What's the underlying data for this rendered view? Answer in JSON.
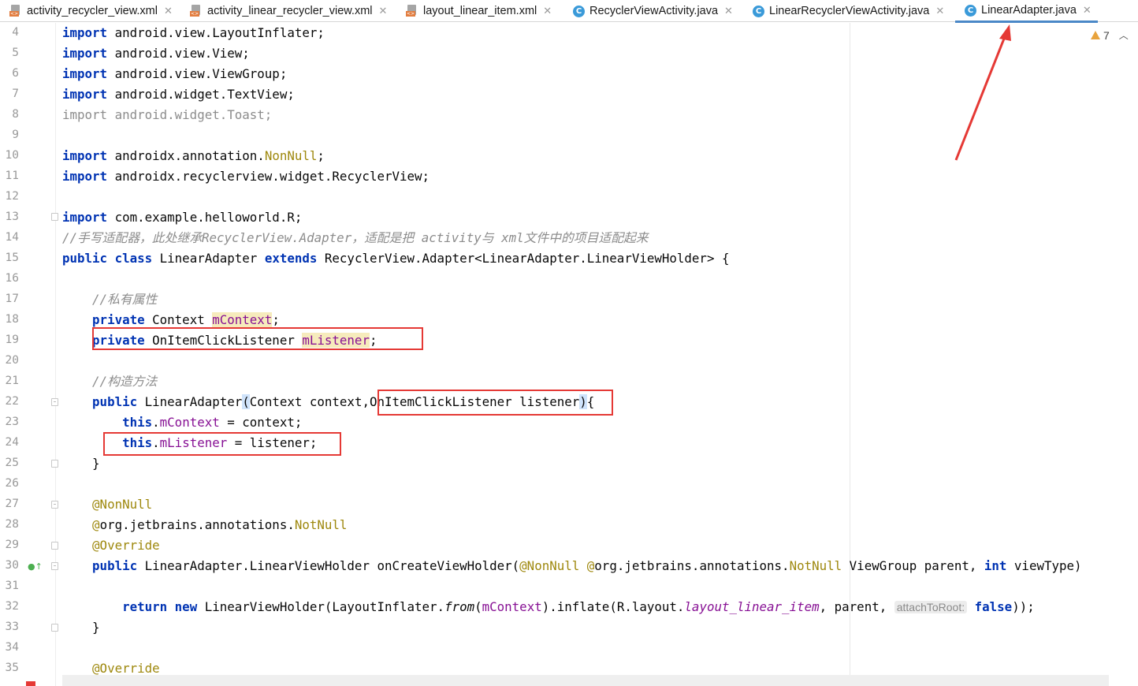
{
  "tabs": [
    {
      "label": "activity_recycler_view.xml",
      "icon": "xml-file-icon",
      "active": false
    },
    {
      "label": "activity_linear_recycler_view.xml",
      "icon": "xml-file-icon",
      "active": false
    },
    {
      "label": "layout_linear_item.xml",
      "icon": "xml-file-icon",
      "active": false
    },
    {
      "label": "RecyclerViewActivity.java",
      "icon": "java-class-icon",
      "active": false
    },
    {
      "label": "LinearRecyclerViewActivity.java",
      "icon": "java-class-icon",
      "active": false
    },
    {
      "label": "LinearAdapter.java",
      "icon": "java-class-icon",
      "active": true
    }
  ],
  "inspection": {
    "warning_count": "7"
  },
  "line_numbers": [
    "4",
    "5",
    "6",
    "7",
    "8",
    "9",
    "10",
    "11",
    "12",
    "13",
    "14",
    "15",
    "16",
    "17",
    "18",
    "19",
    "20",
    "21",
    "22",
    "23",
    "24",
    "25",
    "26",
    "27",
    "28",
    "29",
    "30",
    "31",
    "32",
    "33",
    "34",
    "35"
  ],
  "code_lines": [
    [
      [
        "kw",
        "import"
      ],
      [
        "",
        " android.view.LayoutInflater;"
      ]
    ],
    [
      [
        "kw",
        "import"
      ],
      [
        "",
        " android.view.View;"
      ]
    ],
    [
      [
        "kw",
        "import"
      ],
      [
        "",
        " android.view.ViewGroup;"
      ]
    ],
    [
      [
        "kw",
        "import"
      ],
      [
        "",
        " android.widget.TextView;"
      ]
    ],
    [
      [
        "unused",
        "import android.widget.Toast;"
      ]
    ],
    [],
    [
      [
        "kw",
        "import"
      ],
      [
        "",
        " androidx.annotation."
      ],
      [
        "ann",
        "NonNull"
      ],
      [
        "",
        ";"
      ]
    ],
    [
      [
        "kw",
        "import"
      ],
      [
        "",
        " androidx.recyclerview.widget.RecyclerView;"
      ]
    ],
    [],
    [
      [
        "kw",
        "import"
      ],
      [
        "",
        " com.example.helloworld.R;"
      ]
    ],
    [
      [
        "cmt",
        "//手写适配器，此处继承RecyclerView.Adapter，适配是把 activity与 xml文件中的项目适配起来"
      ]
    ],
    [
      [
        "kw",
        "public class"
      ],
      [
        "",
        " LinearAdapter "
      ],
      [
        "kw",
        "extends"
      ],
      [
        "",
        " RecyclerView.Adapter<LinearAdapter.LinearViewHolder> {"
      ]
    ],
    [],
    [
      [
        "",
        "    "
      ],
      [
        "cmt",
        "//私有属性"
      ]
    ],
    [
      [
        "",
        "    "
      ],
      [
        "kw",
        "private"
      ],
      [
        "",
        " Context "
      ],
      [
        "fldhl",
        "mContext"
      ],
      [
        "",
        ";"
      ]
    ],
    [
      [
        "",
        "    "
      ],
      [
        "kw",
        "private"
      ],
      [
        "",
        " OnItemClickListener "
      ],
      [
        "fldhl",
        "mListener"
      ],
      [
        "",
        ";"
      ]
    ],
    [],
    [
      [
        "",
        "    "
      ],
      [
        "cmt",
        "//构造方法"
      ]
    ],
    [
      [
        "",
        "    "
      ],
      [
        "kw",
        "public"
      ],
      [
        "",
        " LinearAdapter"
      ],
      [
        "brace",
        "("
      ],
      [
        "",
        "Context context,OnItemClickListener listener"
      ],
      [
        "brace",
        ")"
      ],
      [
        "",
        "{"
      ]
    ],
    [
      [
        "",
        "        "
      ],
      [
        "kw",
        "this"
      ],
      [
        "",
        "."
      ],
      [
        "fld",
        "mContext"
      ],
      [
        "",
        " = context;"
      ]
    ],
    [
      [
        "",
        "        "
      ],
      [
        "kw",
        "this"
      ],
      [
        "",
        "."
      ],
      [
        "fld",
        "mListener"
      ],
      [
        "",
        " = listener;"
      ]
    ],
    [
      [
        "",
        "    }"
      ]
    ],
    [],
    [
      [
        "",
        "    "
      ],
      [
        "ann",
        "@NonNull"
      ]
    ],
    [
      [
        "",
        "    "
      ],
      [
        "ann",
        "@"
      ],
      [
        "",
        "org.jetbrains.annotations."
      ],
      [
        "ann",
        "NotNull"
      ]
    ],
    [
      [
        "",
        "    "
      ],
      [
        "ann",
        "@Override"
      ]
    ],
    [
      [
        "",
        "    "
      ],
      [
        "kw",
        "public"
      ],
      [
        "",
        " LinearAdapter.LinearViewHolder onCreateViewHolder("
      ],
      [
        "ann",
        "@NonNull"
      ],
      [
        "",
        " "
      ],
      [
        "ann",
        "@"
      ],
      [
        "",
        "org.jetbrains.annotations."
      ],
      [
        "ann",
        "NotNull"
      ],
      [
        "",
        " ViewGroup parent, "
      ],
      [
        "kw",
        "int"
      ],
      [
        "",
        " viewType)"
      ]
    ],
    [],
    [
      [
        "",
        "        "
      ],
      [
        "kw",
        "return new"
      ],
      [
        "",
        " LinearViewHolder(LayoutInflater."
      ],
      [
        "it",
        "from"
      ],
      [
        "",
        "("
      ],
      [
        "fld",
        "mContext"
      ],
      [
        "",
        ").inflate(R.layout."
      ],
      [
        "stat",
        "layout_linear_item"
      ],
      [
        "",
        ", parent, "
      ],
      [
        "hint",
        "attachToRoot:"
      ],
      [
        "",
        " "
      ],
      [
        "kw",
        "false"
      ],
      [
        "",
        "));"
      ]
    ],
    [
      [
        "",
        "    }"
      ]
    ],
    [],
    [
      [
        "",
        "    "
      ],
      [
        "ann",
        "@Override"
      ]
    ]
  ]
}
